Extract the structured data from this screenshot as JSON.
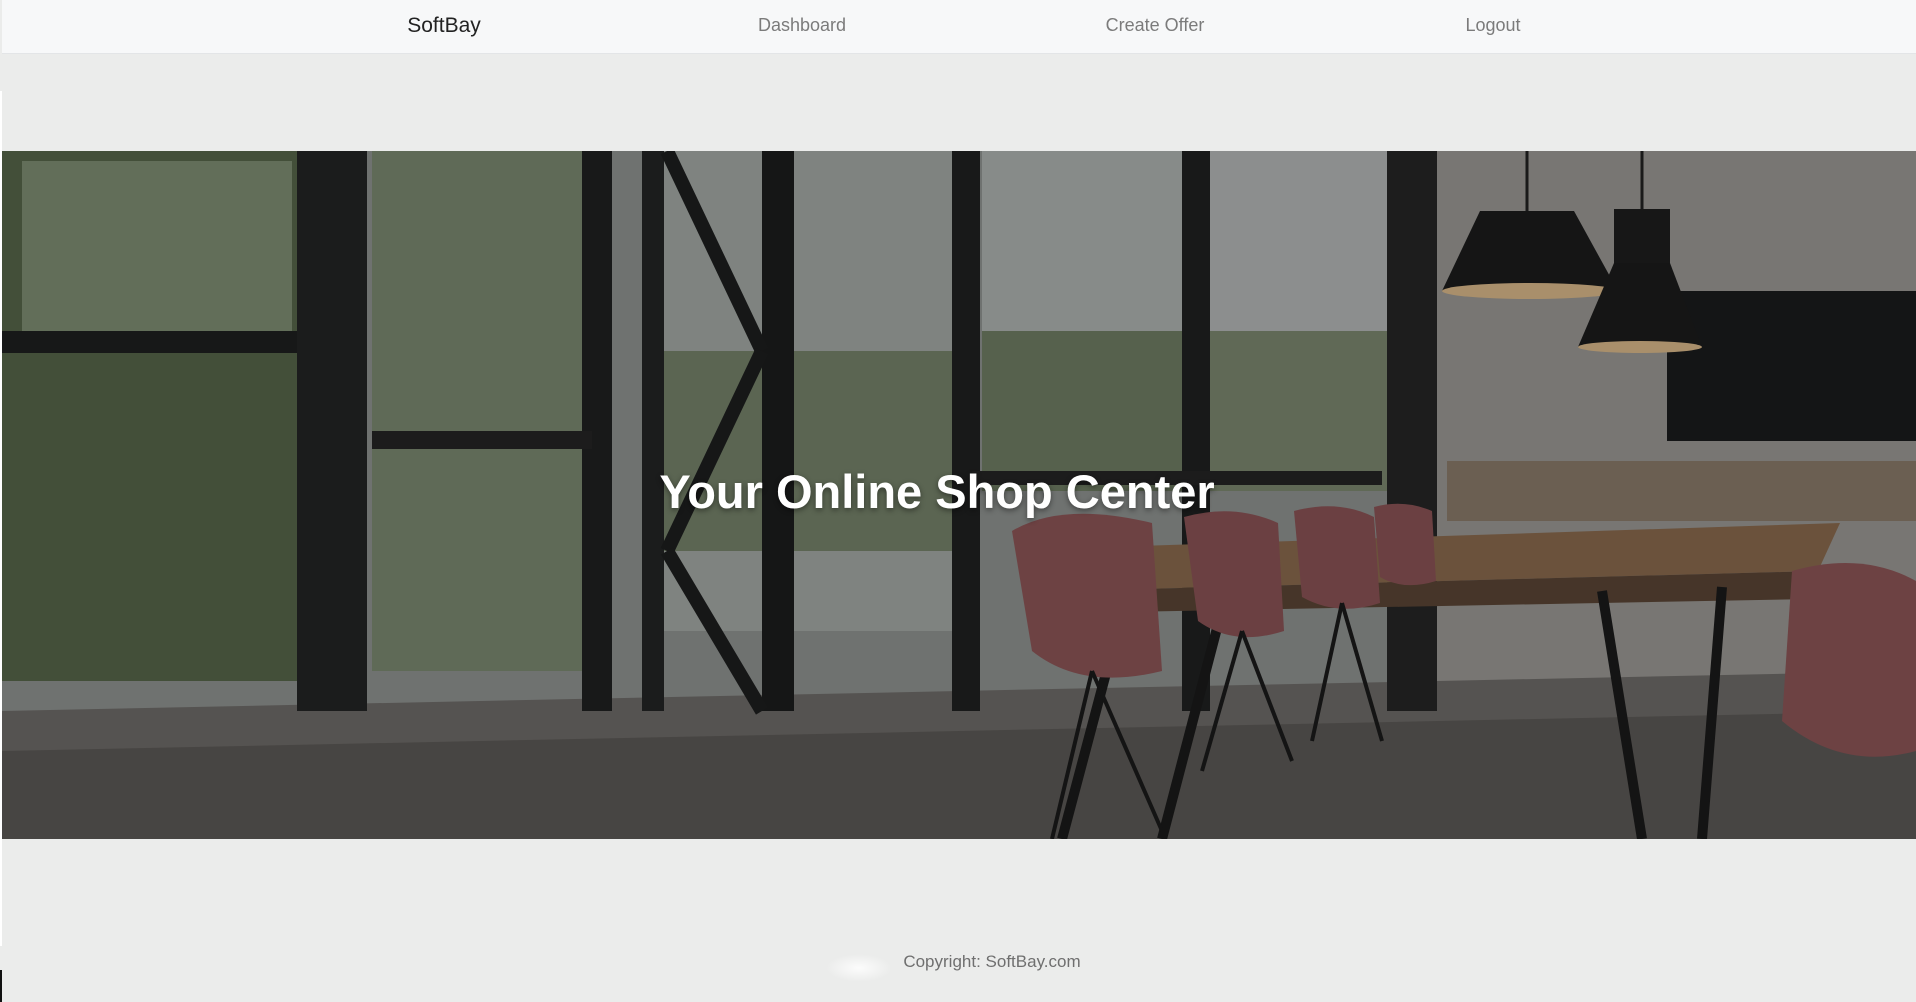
{
  "navbar": {
    "brand": "SoftBay",
    "links": [
      {
        "label": "Dashboard"
      },
      {
        "label": "Create Offer"
      },
      {
        "label": "Logout"
      }
    ]
  },
  "hero": {
    "title": "Your Online Shop Center",
    "image_description_icon": "interior-photo"
  },
  "footer": {
    "copyright": "Copyright: SoftBay.com"
  },
  "colors": {
    "page_background": "#ebeceb",
    "navbar_background": "#f7f8f9",
    "nav_link": "#7b7b7b",
    "brand": "#222222",
    "hero_text": "#ffffff"
  }
}
